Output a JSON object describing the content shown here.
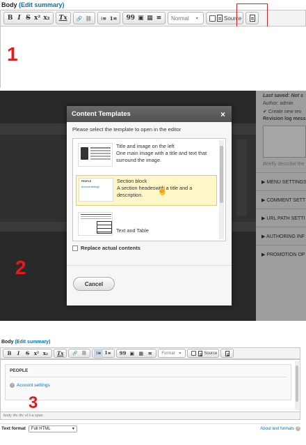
{
  "panel1": {
    "field_label": "Body",
    "edit_summary": "(Edit summary)",
    "toolbar": {
      "bold": "B",
      "italic": "I",
      "strike": "S",
      "superscript": "x²",
      "subscript": "x₂",
      "remove_format": "Tx",
      "link": "🔗",
      "unlink": "⛓",
      "bullet_list": "⁝≡",
      "numbered_list": "1≡",
      "blockquote": "99",
      "image": "▣",
      "table": "▦",
      "hr": "≡",
      "format_label": "Normal",
      "source_label": "Source"
    },
    "step_number": "1",
    "highlight_color": "#e21b1b"
  },
  "panel2": {
    "sidebar": {
      "last_saved": "Last saved: Not s",
      "author": "Author: admin",
      "create_new": "✔ Create new rev",
      "revision_log": "Revision log mess",
      "describe": "Briefly describe the",
      "items": [
        "▶ MENU SETTINGS",
        "▶ COMMENT SETT",
        "▶ URL PATH SETTI",
        "▶ AUTHORING INF",
        "▶ PROMOTION OP"
      ]
    },
    "modal": {
      "title": "Content Templates",
      "close": "×",
      "prompt": "Please select the template to open in the editor",
      "templates": [
        {
          "title": "Title and image on the left",
          "desc": "One main image with a title and text that surround the image."
        },
        {
          "title": "Section block",
          "desc": "A section headeswith a title and a description."
        },
        {
          "title": "Text and Table",
          "desc": ""
        }
      ],
      "thumb_section_header": "PEOPLE",
      "thumb_section_link": "Account settings",
      "replace_label": "Replace actual contents",
      "cancel_label": "Cancel"
    },
    "step_number": "2"
  },
  "panel3": {
    "field_label": "Body",
    "edit_summary": "(Edit summary)",
    "toolbar": {
      "format_label": "Format",
      "source_label": "Source"
    },
    "section_title": "PEOPLE",
    "section_link": "Account settings",
    "step_number": "3",
    "element_path": "body  div  div  ul  li  a  span",
    "text_format_label": "Text format",
    "text_format_value": "Full HTML",
    "about_formats": "About text formats"
  }
}
